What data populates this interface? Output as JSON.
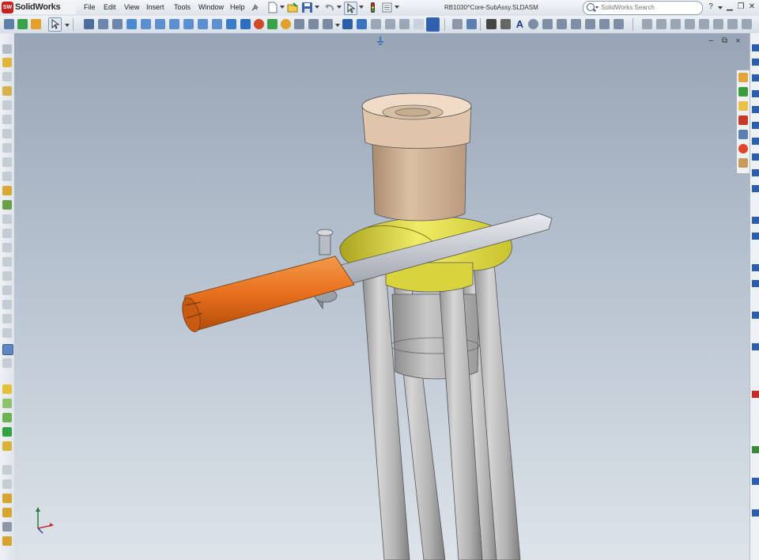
{
  "app": {
    "name": "SolidWorks",
    "logo_text": "SW",
    "document_title": "RB1030^Core-SubAssy.SLDASM"
  },
  "menu": {
    "items": [
      {
        "label": "File"
      },
      {
        "label": "Edit"
      },
      {
        "label": "View"
      },
      {
        "label": "Insert"
      },
      {
        "label": "Tools"
      },
      {
        "label": "Window"
      },
      {
        "label": "Help"
      }
    ]
  },
  "search": {
    "placeholder": "SolidWorks Search"
  },
  "help": {
    "label": "?"
  },
  "window_controls": {
    "minimize": "▁",
    "restore": "❐",
    "close": "✕"
  },
  "viewport_controls": {
    "minimize": "–",
    "restore": "⧉",
    "close": "×"
  },
  "colors": {
    "accent_brand": "#c8211b",
    "part_orange": "#e8701e",
    "part_yellow": "#e5e14a",
    "part_tan": "#d9bba0",
    "part_gray": "#b8b8b8"
  },
  "icons": {
    "triad": "coordinate-triad-icon",
    "pin": "pin-icon"
  }
}
